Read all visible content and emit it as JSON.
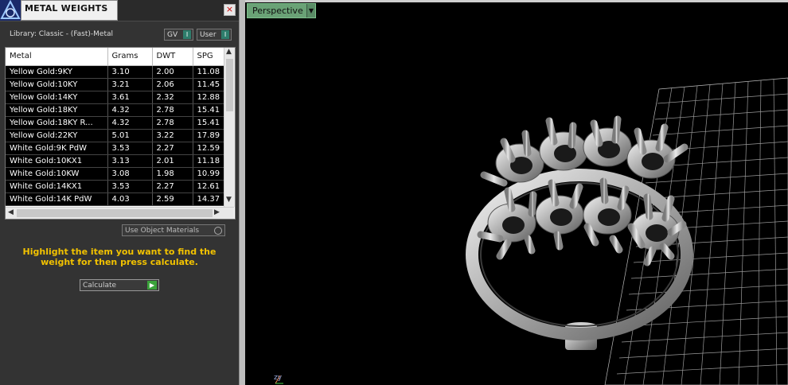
{
  "panel": {
    "title": "METAL WEIGHTS",
    "close_glyph": "×",
    "library_label": "Library: Classic - (Fast)-Metal",
    "toggles": [
      {
        "label": "GV",
        "state": "I"
      },
      {
        "label": "User",
        "state": "I"
      }
    ],
    "table": {
      "columns": [
        "Metal",
        "Grams",
        "DWT",
        "SPG"
      ],
      "rows": [
        [
          "Yellow Gold:9KY",
          "3.10",
          "2.00",
          "11.08"
        ],
        [
          "Yellow Gold:10KY",
          "3.21",
          "2.06",
          "11.45"
        ],
        [
          "Yellow Gold:14KY",
          "3.61",
          "2.32",
          "12.88"
        ],
        [
          "Yellow Gold:18KY",
          "4.32",
          "2.78",
          "15.41"
        ],
        [
          "Yellow Gold:18KY R...",
          "4.32",
          "2.78",
          "15.41"
        ],
        [
          "Yellow Gold:22KY",
          "5.01",
          "3.22",
          "17.89"
        ],
        [
          "White Gold:9K PdW",
          "3.53",
          "2.27",
          "12.59"
        ],
        [
          "White Gold:10KX1",
          "3.13",
          "2.01",
          "11.18"
        ],
        [
          "White Gold:10KW",
          "3.08",
          "1.98",
          "10.99"
        ],
        [
          "White Gold:14KX1",
          "3.53",
          "2.27",
          "12.61"
        ],
        [
          "White Gold:14K PdW",
          "4.03",
          "2.59",
          "14.37"
        ]
      ]
    },
    "use_object_materials": "Use Object Materials",
    "hint": "Highlight the item you want to find the weight for then press calculate.",
    "calculate_label": "Calculate"
  },
  "viewport": {
    "view_mode": "Perspective",
    "axis_label": "zy"
  },
  "colors": {
    "hint_yellow": "#f2c200",
    "view_green": "#6aa276",
    "toggle_teal": "#2e7d6c"
  }
}
